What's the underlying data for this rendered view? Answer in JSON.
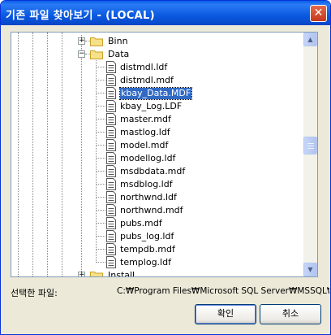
{
  "window": {
    "title": "기존 파일 찾아보기 - (LOCAL)"
  },
  "tree": {
    "folders": [
      {
        "label": "Binn",
        "expander": "+"
      },
      {
        "label": "Data",
        "expander": "−"
      },
      {
        "label": "Install",
        "expander": "+"
      }
    ],
    "files": [
      "distmdl.ldf",
      "distmdl.mdf",
      "kbay_Data.MDF",
      "kbay_Log.LDF",
      "master.mdf",
      "mastlog.ldf",
      "model.mdf",
      "modellog.ldf",
      "msdbdata.mdf",
      "msdblog.ldf",
      "northwnd.ldf",
      "northwnd.mdf",
      "pubs.mdf",
      "pubs_log.ldf",
      "tempdb.mdf",
      "templog.ldf"
    ],
    "selected_file": "kbay_Data.MDF"
  },
  "footer": {
    "selected_label": "선택한 파일:",
    "selected_path": "C:₩Program Files₩Microsoft SQL Server₩MSSQL₩D",
    "ok_label": "확인",
    "cancel_label": "취소"
  },
  "colors": {
    "title_bar": "#0A5FE8",
    "selection": "#316AC5",
    "dialog_bg": "#ECE9D8"
  }
}
